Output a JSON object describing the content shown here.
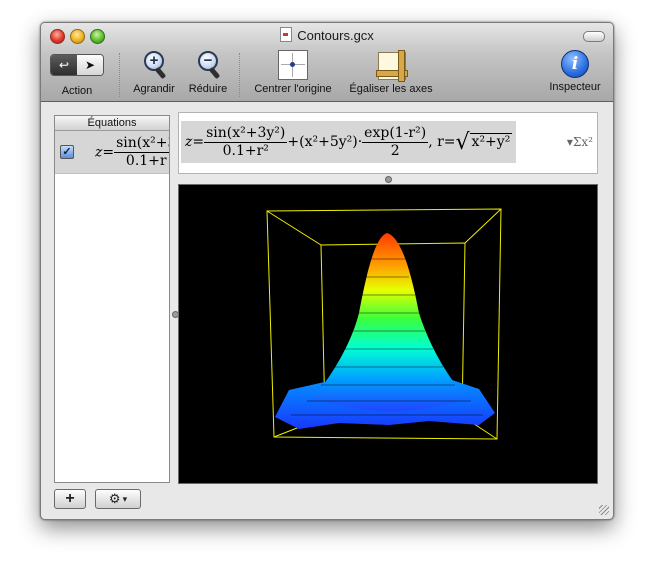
{
  "window": {
    "title": "Contours.gcx"
  },
  "toolbar": {
    "action_label": "Action",
    "zoom_in_label": "Agrandir",
    "zoom_out_label": "Réduire",
    "center_label": "Centrer l'origine",
    "equalize_label": "Égaliser les axes",
    "inspector_label": "Inspecteur"
  },
  "sidebar": {
    "header": "Équations",
    "items": [
      {
        "checked": true,
        "lhs": "z=",
        "numerator": "sin(x²+3",
        "denominator": "0.1+r"
      }
    ]
  },
  "equation": {
    "z": "z=",
    "num1": "sin(x²+3y²)",
    "den1": "0.1+r²",
    "mid": "+(x²+5y²)·",
    "num2": "exp(1-r²)",
    "den2": "2",
    "r": ", r=",
    "radicand": "x²+y²",
    "sigma": "▾Σx²"
  },
  "graph": {
    "type": "3D surface contour plot",
    "colors": [
      "#ff3a00",
      "#ff9d00",
      "#e8ff00",
      "#3cff3c",
      "#00ffd5",
      "#00a0ff",
      "#1e46ff"
    ],
    "bounding_box_color": "#f0f000"
  },
  "icons": {
    "gear": "⚙",
    "plus": "+",
    "dropdown": "▾"
  }
}
